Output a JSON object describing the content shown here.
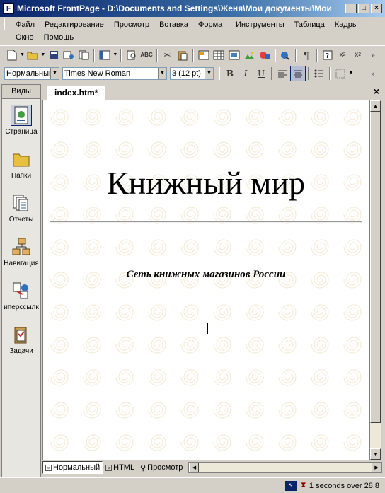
{
  "window": {
    "title": "Microsoft FrontPage - D:\\Documents and Settings\\Женя\\Мои документы\\Мои"
  },
  "menu": {
    "items": [
      "Файл",
      "Редактирование",
      "Просмотр",
      "Вставка",
      "Формат",
      "Инструменты",
      "Таблица",
      "Кадры",
      "Окно",
      "Помощь"
    ]
  },
  "format_toolbar": {
    "style": "Нормальный",
    "font": "Times New Roman",
    "size": "3  (12 pt)"
  },
  "views": {
    "header": "Виды",
    "items": [
      {
        "label": "Страница",
        "icon": "page-view-icon"
      },
      {
        "label": "Папки",
        "icon": "folder-icon"
      },
      {
        "label": "Отчеты",
        "icon": "reports-icon"
      },
      {
        "label": "Навигация",
        "icon": "navigation-icon"
      },
      {
        "label": "иперссылк",
        "icon": "hyperlinks-icon"
      },
      {
        "label": "Задачи",
        "icon": "tasks-icon"
      }
    ]
  },
  "document": {
    "tab_label": "index.htm*",
    "heading": "Книжный мир",
    "subtitle": "Сеть книжных магазинов России"
  },
  "view_tabs": {
    "normal": "Нормальный",
    "html": "HTML",
    "preview": "Просмотр"
  },
  "status": {
    "text": "1 seconds over 28.8"
  },
  "colors": {
    "titlebar_start": "#0a246a",
    "titlebar_end": "#a6caf0",
    "chrome": "#d4d0c8"
  }
}
